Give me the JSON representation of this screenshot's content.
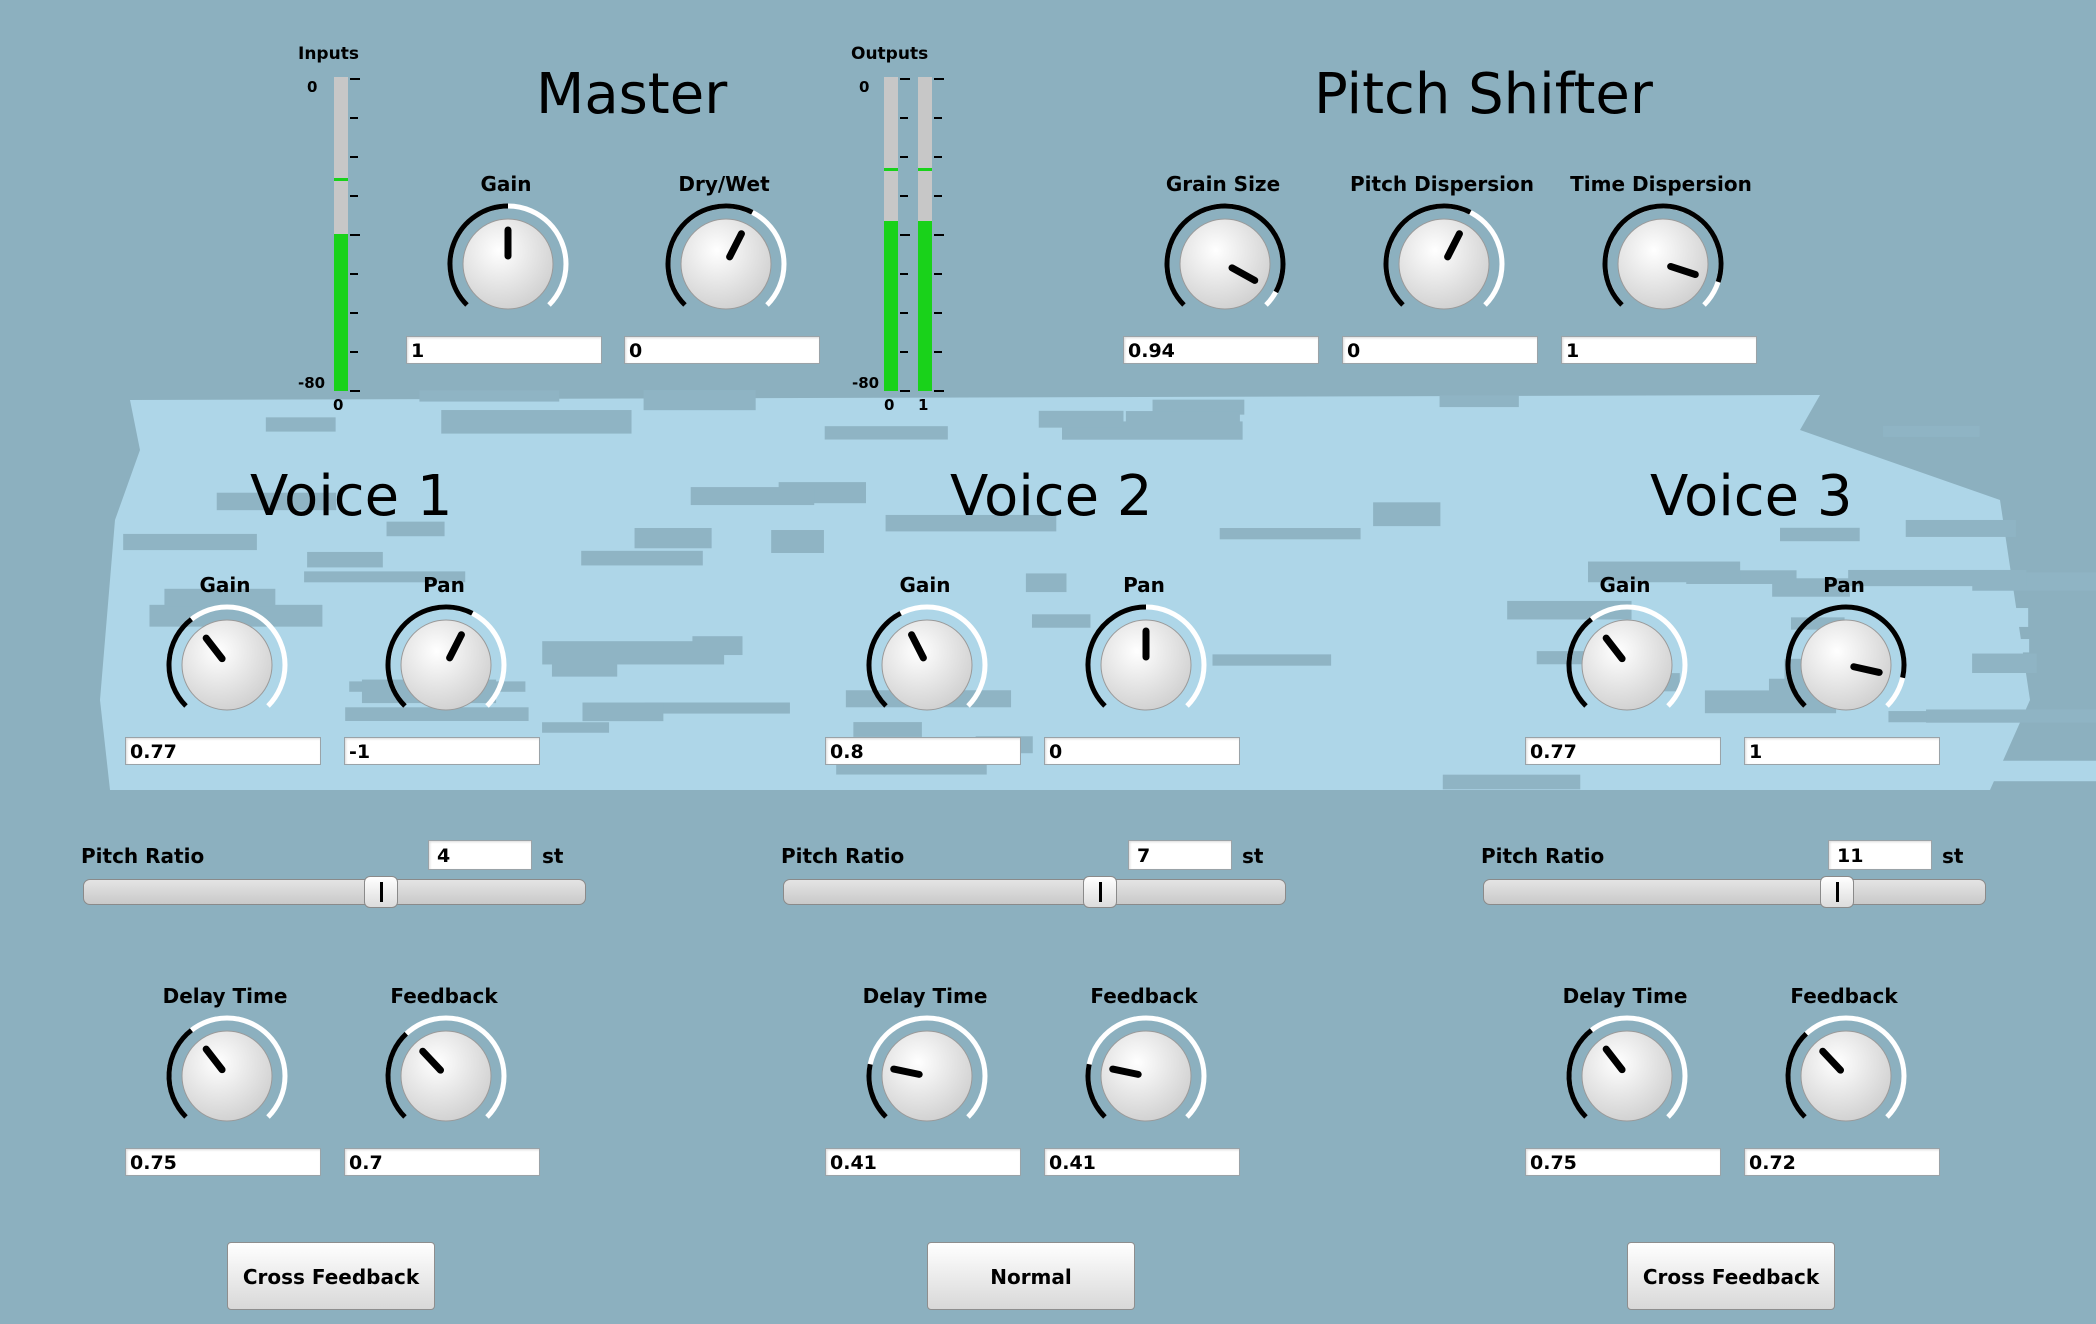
{
  "colors": {
    "background": "#8cb0bf",
    "meter_fill": "#19d21a",
    "knob_arc_dark": "#000000",
    "knob_arc_light": "#ffffff"
  },
  "inputs_meter": {
    "title": "Inputs",
    "top_label": "0",
    "bottom_label": "-80",
    "channel_labels": [
      "0"
    ],
    "levels": [
      0.5
    ],
    "peaks": [
      0.67
    ]
  },
  "outputs_meter": {
    "title": "Outputs",
    "top_label": "0",
    "bottom_label": "-80",
    "channel_labels": [
      "0",
      "1"
    ],
    "levels": [
      0.54,
      0.54
    ],
    "peaks": [
      0.7,
      0.7
    ]
  },
  "master": {
    "title": "Master",
    "knobs": [
      {
        "label": "Gain",
        "value": "1",
        "fraction": 0.5
      },
      {
        "label": "Dry/Wet",
        "value": "0",
        "fraction": 0.6
      }
    ]
  },
  "pitch_shifter": {
    "title": "Pitch Shifter",
    "knobs": [
      {
        "label": "Grain Size",
        "value": "0.94",
        "fraction": 0.94
      },
      {
        "label": "Pitch Dispersion",
        "value": "0",
        "fraction": 0.6
      },
      {
        "label": "Time Dispersion",
        "value": "1",
        "fraction": 0.9
      }
    ]
  },
  "voices": [
    {
      "title": "Voice 1",
      "gain": {
        "label": "Gain",
        "value": "0.77",
        "fraction": 0.36
      },
      "pan": {
        "label": "Pan",
        "value": "-1",
        "fraction": 0.6
      },
      "pitch": {
        "label": "Pitch Ratio",
        "value": "4",
        "unit": "st",
        "fraction": 0.6
      },
      "delay": {
        "label": "Delay Time",
        "value": "0.75",
        "fraction": 0.36
      },
      "feedback": {
        "label": "Feedback",
        "value": "0.7",
        "fraction": 0.34
      },
      "mode_button": "Cross Feedback"
    },
    {
      "title": "Voice 2",
      "gain": {
        "label": "Gain",
        "value": "0.8",
        "fraction": 0.4
      },
      "pan": {
        "label": "Pan",
        "value": "0",
        "fraction": 0.5
      },
      "pitch": {
        "label": "Pitch Ratio",
        "value": "7",
        "unit": "st",
        "fraction": 0.64
      },
      "delay": {
        "label": "Delay Time",
        "value": "0.41",
        "fraction": 0.21
      },
      "feedback": {
        "label": "Feedback",
        "value": "0.41",
        "fraction": 0.21
      },
      "mode_button": "Normal"
    },
    {
      "title": "Voice 3",
      "gain": {
        "label": "Gain",
        "value": "0.77",
        "fraction": 0.36
      },
      "pan": {
        "label": "Pan",
        "value": "1",
        "fraction": 0.88
      },
      "pitch": {
        "label": "Pitch Ratio",
        "value": "11",
        "unit": "st",
        "fraction": 0.72
      },
      "delay": {
        "label": "Delay Time",
        "value": "0.75",
        "fraction": 0.36
      },
      "feedback": {
        "label": "Feedback",
        "value": "0.72",
        "fraction": 0.34
      },
      "mode_button": "Cross Feedback"
    }
  ]
}
